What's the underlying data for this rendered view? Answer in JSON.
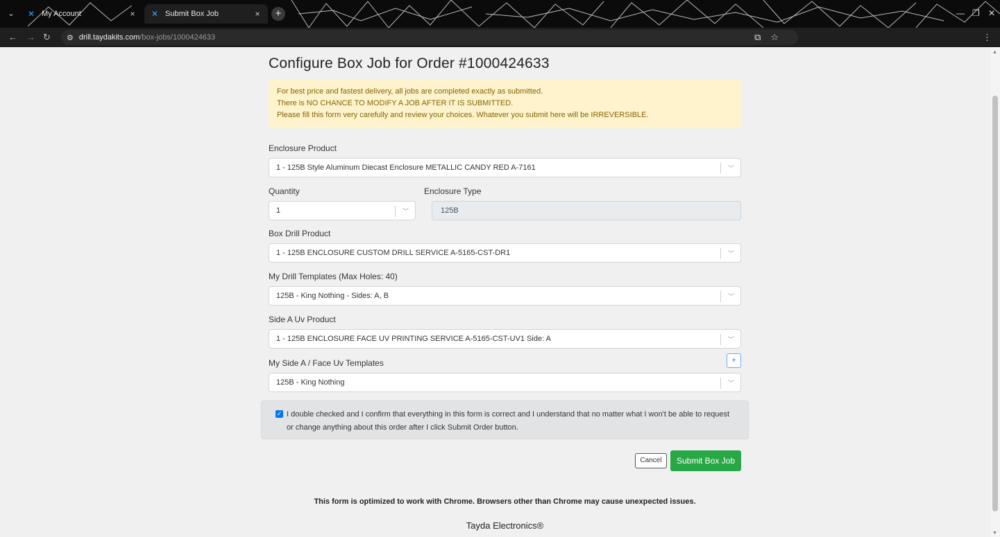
{
  "browser": {
    "tabs": [
      {
        "title": "My Account",
        "active": false
      },
      {
        "title": "Submit Box Job",
        "active": true
      }
    ],
    "url_host": "drill.taydakits.com",
    "url_path": "/box-jobs/1000424633"
  },
  "page": {
    "title": "Configure Box Job for Order #1000424633",
    "alert_lines": [
      "For best price and fastest delivery, all jobs are completed exactly as submitted.",
      "There is NO CHANCE TO MODIFY A JOB AFTER IT IS SUBMITTED.",
      "Please fill this form very carefully and review your choices. Whatever you submit here will be IRREVERSIBLE."
    ],
    "enclosure_product": {
      "label": "Enclosure Product",
      "value": "1 - 125B Style Aluminum Diecast Enclosure METALLIC CANDY RED A-7161"
    },
    "quantity": {
      "label": "Quantity",
      "value": "1"
    },
    "enclosure_type": {
      "label": "Enclosure Type",
      "value": "125B"
    },
    "box_drill_product": {
      "label": "Box Drill Product",
      "value": "1 - 125B ENCLOSURE CUSTOM DRILL SERVICE A-5165-CST-DR1"
    },
    "drill_templates": {
      "label": "My Drill Templates (Max Holes: 40)",
      "value": "125B - King Nothing - Sides: A, B"
    },
    "side_a_uv_product": {
      "label": "Side A Uv Product",
      "value": "1 - 125B ENCLOSURE FACE UV PRINTING SERVICE A-5165-CST-UV1 Side: A"
    },
    "side_a_uv_templates": {
      "label": "My Side A / Face Uv Templates",
      "value": "125B - King Nothing",
      "add_label": "+"
    },
    "confirm_text": "I double checked and I confirm that everything in this form is correct and I understand that no matter what I won't be able to request or change anything about this order after I click Submit Order button.",
    "confirm_checked": true,
    "cancel_label": "Cancel",
    "submit_label": "Submit Box Job",
    "footer_note": "This form is optimized to work with Chrome. Browsers other than Chrome may cause unexpected issues.",
    "footer_brand": "Tayda Electronics®"
  },
  "colors": {
    "alert_bg": "#fff3cd",
    "alert_text": "#856404",
    "submit_bg": "#28a745",
    "checkbox": "#0075ff"
  }
}
